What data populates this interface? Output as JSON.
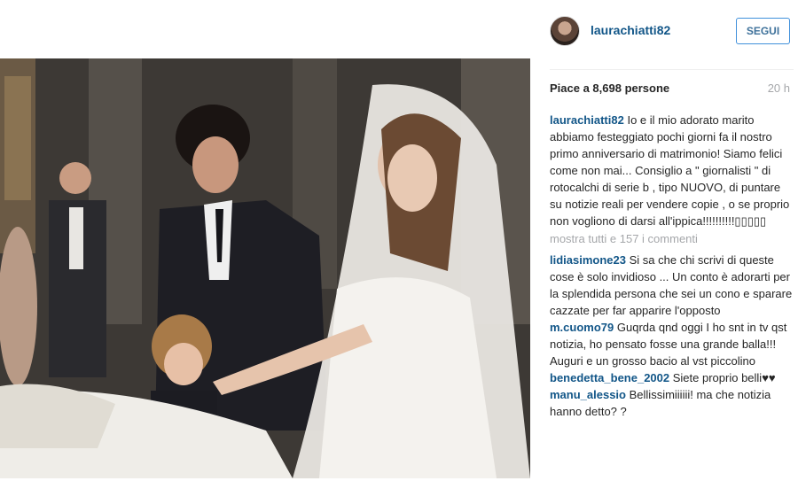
{
  "post": {
    "username": "laurachiatti82",
    "follow_label": "SEGUI",
    "likes": "Piace a 8,698 persone",
    "time": "20 h",
    "caption": {
      "user": "laurachiatti82",
      "text": "Io e il mio adorato marito abbiamo festeggiato pochi giorni fa il nostro primo anniversario di matrimonio! Siamo felici come non mai... Consiglio a \" giornalisti \" di rotocalchi di serie b , tipo NUOVO, di puntare su notizie reali per vendere copie , o se proprio non vogliono di darsi all'ippica!!!!!!!!!!▯▯▯▯▯"
    },
    "show_all_label": "mostra tutti e 157 i commenti",
    "comments": [
      {
        "user": "lidiasimone23",
        "text": "Si sa che chi scrivi di queste cose è solo invidioso ... Un conto è adorarti per la splendida persona che sei un cono e sparare cazzate per far apparire l'opposto"
      },
      {
        "user": "m.cuomo79",
        "text": "Guqrda qnd oggi I ho snt in tv qst notizia, ho pensato fosse una grande balla!!! Auguri e un grosso bacio al vst piccolino"
      },
      {
        "user": "benedetta_bene_2002",
        "text": "Siete proprio belli♥♥"
      },
      {
        "user": "manu_alessio",
        "text": "Bellissimiiiiii! ma che notizia hanno detto? ?"
      }
    ]
  },
  "icons": {
    "avatar": "profile-avatar"
  },
  "colors": {
    "username": "#125688",
    "follow_border": "#4090db",
    "muted": "#a5a7aa"
  }
}
